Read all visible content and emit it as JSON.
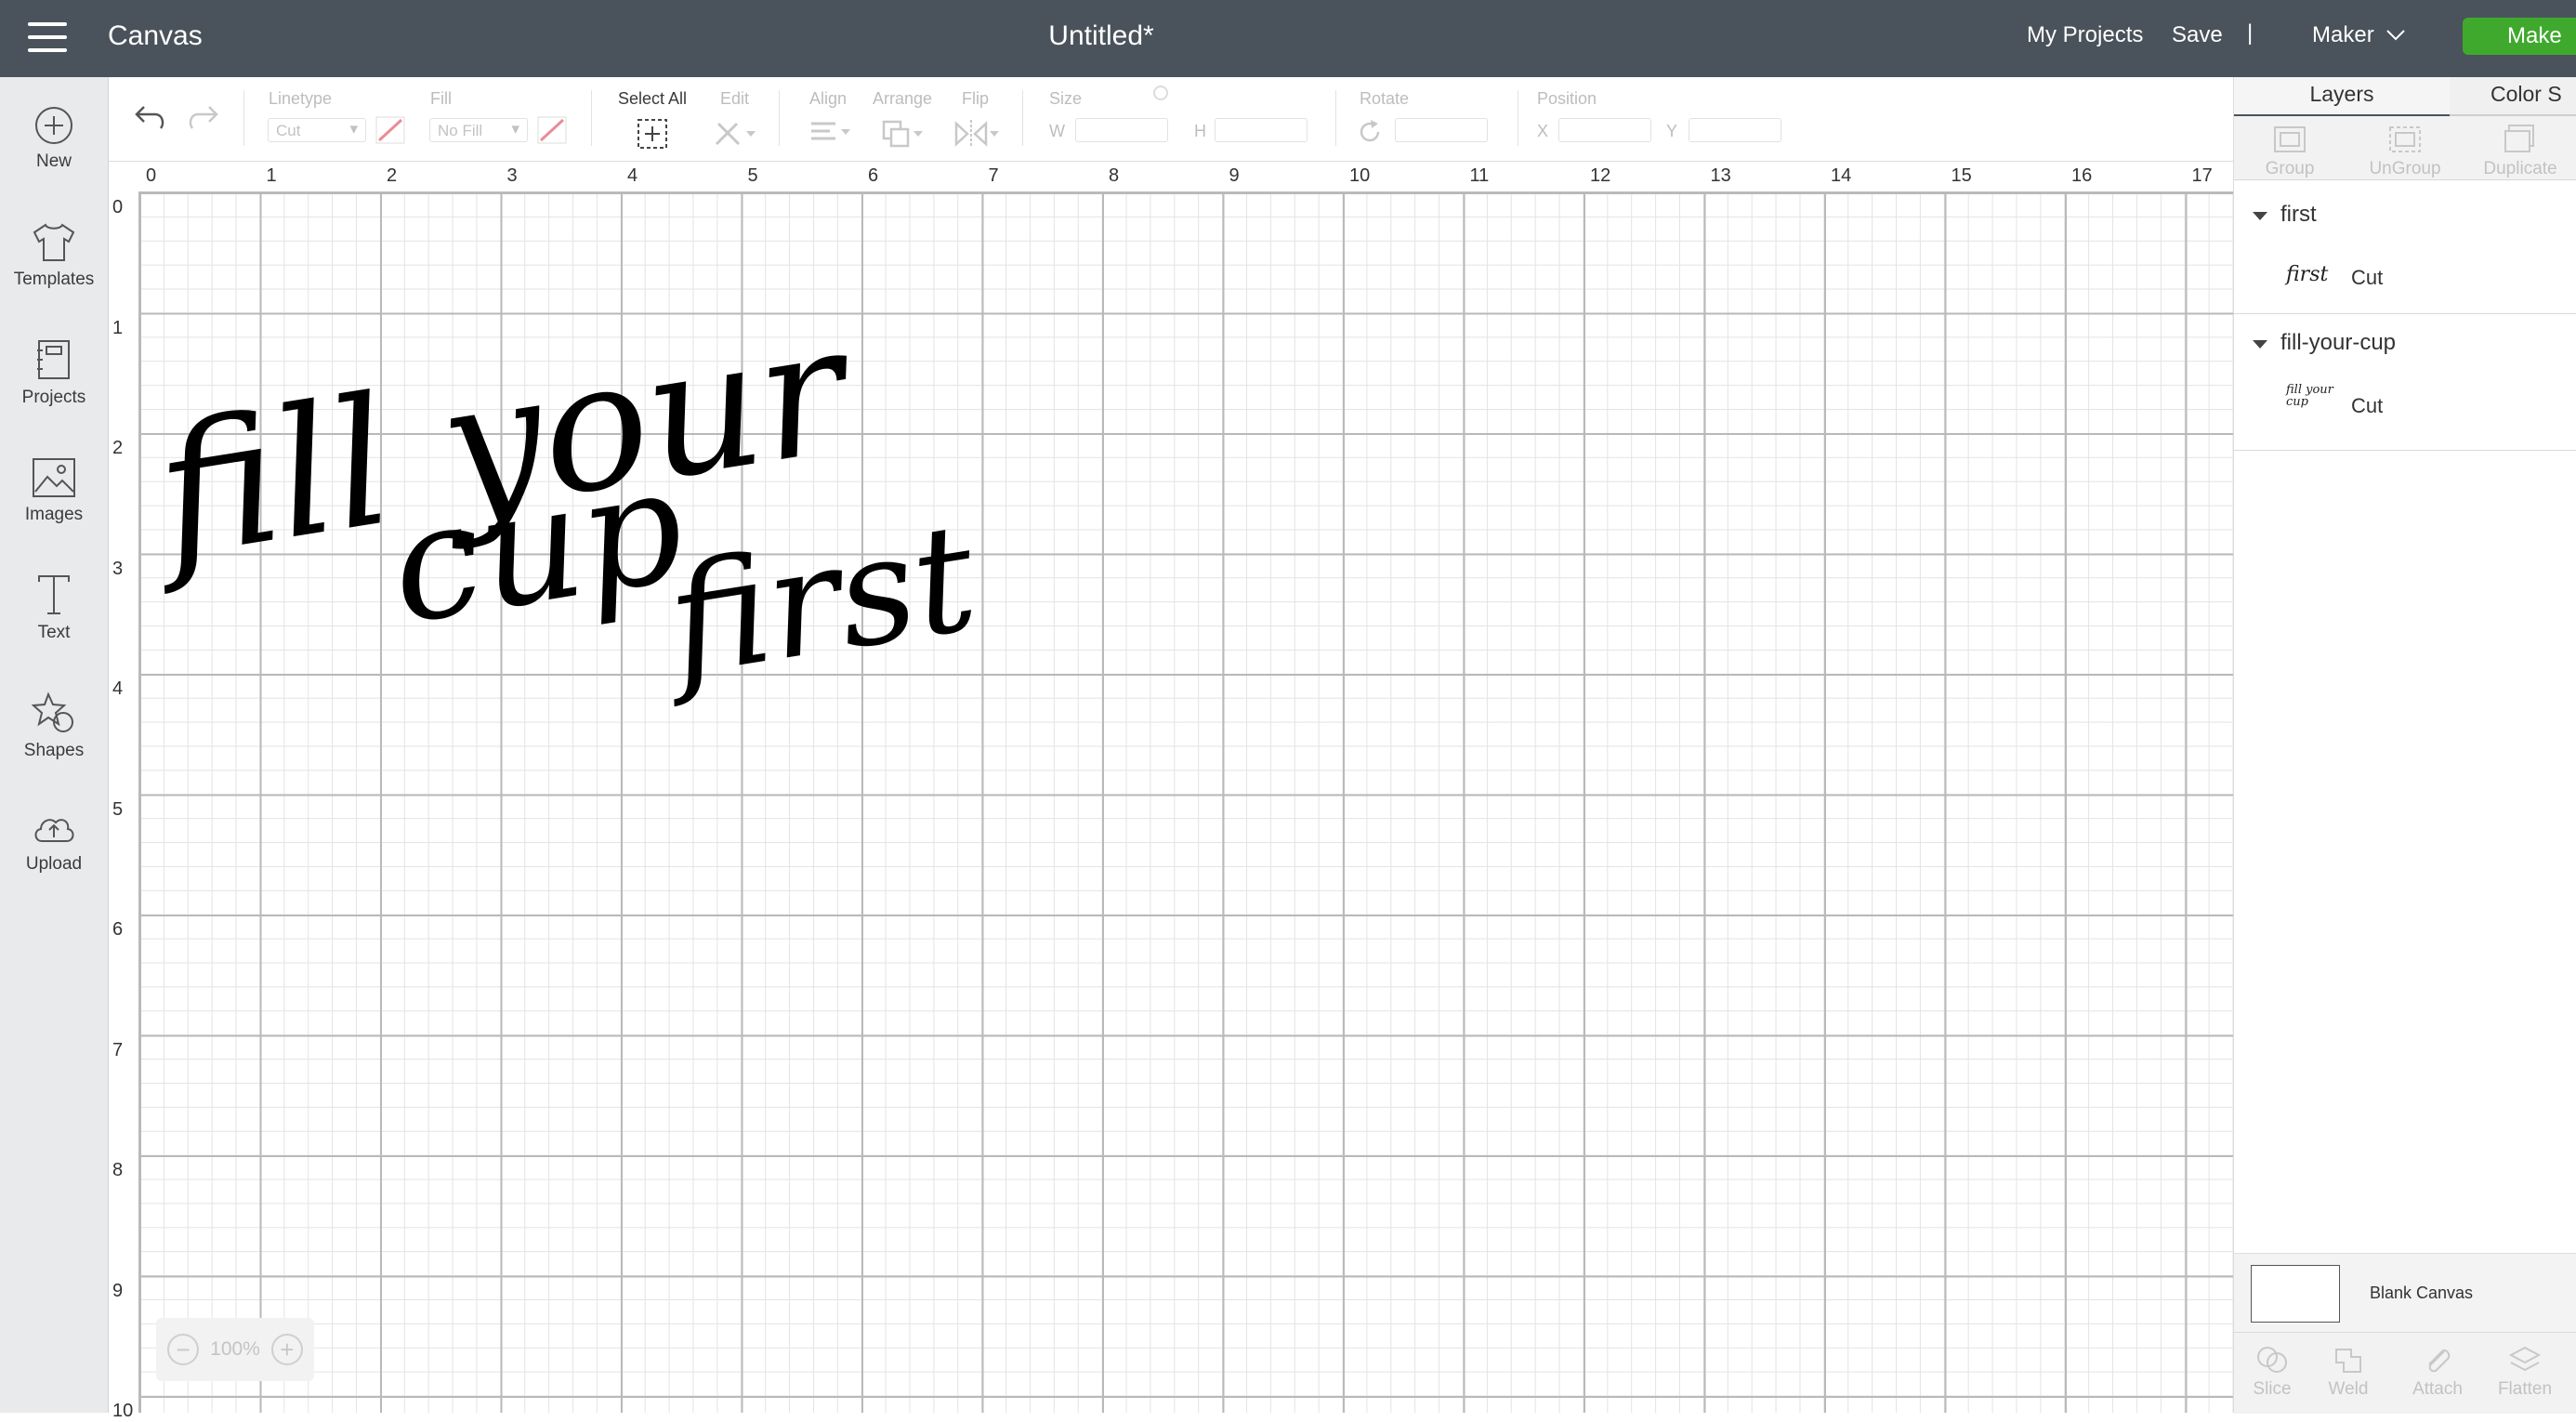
{
  "topbar": {
    "app_title": "Canvas",
    "doc_title": "Untitled*",
    "my_projects": "My Projects",
    "save": "Save",
    "separator": "|",
    "machine": "Maker",
    "make": "Make",
    "bg_color": "#4a535b",
    "make_color": "#3fa92d"
  },
  "leftbar": {
    "items": [
      {
        "label": "New",
        "icon": "plus-circle-icon"
      },
      {
        "label": "Templates",
        "icon": "tshirt-icon"
      },
      {
        "label": "Projects",
        "icon": "projects-icon"
      },
      {
        "label": "Images",
        "icon": "image-icon"
      },
      {
        "label": "Text",
        "icon": "text-icon"
      },
      {
        "label": "Shapes",
        "icon": "shapes-icon"
      },
      {
        "label": "Upload",
        "icon": "upload-cloud-icon"
      }
    ]
  },
  "toolbar": {
    "linetype_label": "Linetype",
    "linetype_value": "Cut",
    "fill_label": "Fill",
    "fill_value": "No Fill",
    "select_all": "Select All",
    "edit": "Edit",
    "align": "Align",
    "arrange": "Arrange",
    "flip": "Flip",
    "size": "Size",
    "w": "W",
    "h": "H",
    "rotate": "Rotate",
    "position": "Position",
    "x": "X",
    "y": "Y"
  },
  "ruler": {
    "top": [
      "0",
      "1",
      "2",
      "3",
      "4",
      "5",
      "6",
      "7",
      "8",
      "9",
      "10",
      "11",
      "12",
      "13",
      "14",
      "15",
      "16",
      "17"
    ],
    "left": [
      "0",
      "1",
      "2",
      "3",
      "4",
      "5",
      "6",
      "7",
      "8",
      "9",
      "10"
    ]
  },
  "canvas_text": {
    "line1": "fill your",
    "line2": "cup",
    "line3": "first"
  },
  "zoom": {
    "minus": "−",
    "value": "100%",
    "plus": "+"
  },
  "rightpanel": {
    "tabs": [
      "Layers",
      "Color S"
    ],
    "layer_tools": [
      "Group",
      "UnGroup",
      "Duplicate"
    ],
    "groups": [
      {
        "name": "first",
        "thumb": "first",
        "op": "Cut"
      },
      {
        "name": "fill-your-cup",
        "thumb": "fill your cup",
        "op": "Cut"
      }
    ],
    "blank_canvas": "Blank Canvas",
    "bottom_tools": [
      "Slice",
      "Weld",
      "Attach",
      "Flatten"
    ]
  }
}
